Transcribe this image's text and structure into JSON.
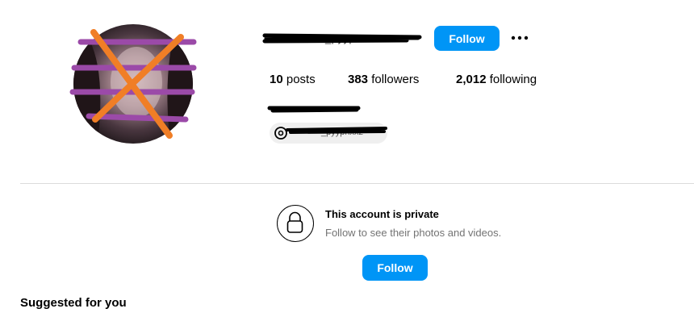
{
  "profile": {
    "username": "_pyypnxxz",
    "follow_label": "Follow",
    "more_icon": "more-horizontal-icon",
    "avatar_overlay_colors": {
      "stripes": "#9b4aa8",
      "cross": "#f07e26"
    }
  },
  "stats": [
    {
      "count": "10",
      "label": "posts"
    },
    {
      "count": "383",
      "label": "followers"
    },
    {
      "count": "2,012",
      "label": "following"
    }
  ],
  "bio": {
    "name": "",
    "link_text": "_pyypnxxz",
    "link_icon": "threads-icon"
  },
  "private": {
    "icon": "lock-icon",
    "title": "This account is private",
    "subtitle": "Follow to see their photos and videos.",
    "follow_label": "Follow"
  },
  "suggested": {
    "heading": "Suggested for you"
  },
  "colors": {
    "accent": "#0095f6",
    "divider": "#dbdbdb",
    "secondary_text": "#737373"
  }
}
